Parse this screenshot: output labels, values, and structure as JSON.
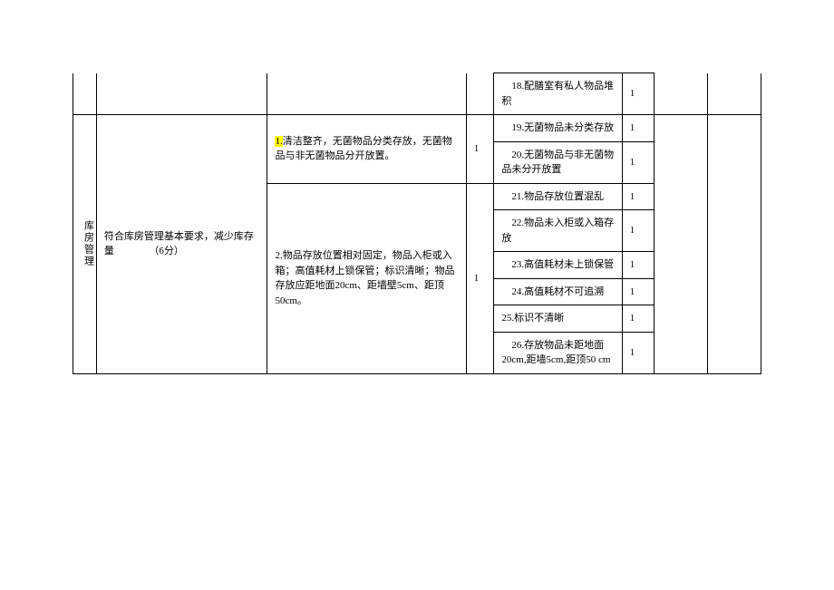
{
  "category": "库房管理",
  "requirement": "符合库房管理基本要求，减少库存量　　　　（6分）",
  "detailRow1": {
    "prefix": "1.",
    "text": "清洁整齐，无菌物品分类存放，无菌物品与非无菌物品分开放置。",
    "score": "1"
  },
  "detailRow2": {
    "text": "2.物品存放位置相对固定，物品入柜或入箱；高值耗材上锁保管；标识清晰；物品存放应距地面20cm、距墙壁5cm、距顶50cm。",
    "score": "1"
  },
  "issues": {
    "i18": {
      "text": "　18.配膳室有私人物品堆积",
      "score": "1"
    },
    "i19": {
      "text": "　19.无菌物品未分类存放",
      "score": "1"
    },
    "i20": {
      "text": "　20.无菌物品与非无菌物品未分开放置",
      "score": "1"
    },
    "i21": {
      "text": "　21.物品存放位置混乱",
      "score": "1"
    },
    "i22": {
      "text": "　22.物品未入柜或入箱存放",
      "score": "1"
    },
    "i23": {
      "text": "　23.高值耗材未上锁保管",
      "score": "1"
    },
    "i24": {
      "text": "　24.高值耗材不可追溯",
      "score": "1"
    },
    "i25": {
      "text": "25.标识不清晰",
      "score": "1"
    },
    "i26": {
      "text": "　26.存放物品未距地面20cm,距墙5cm,距顶50 cm",
      "score": "1"
    }
  }
}
